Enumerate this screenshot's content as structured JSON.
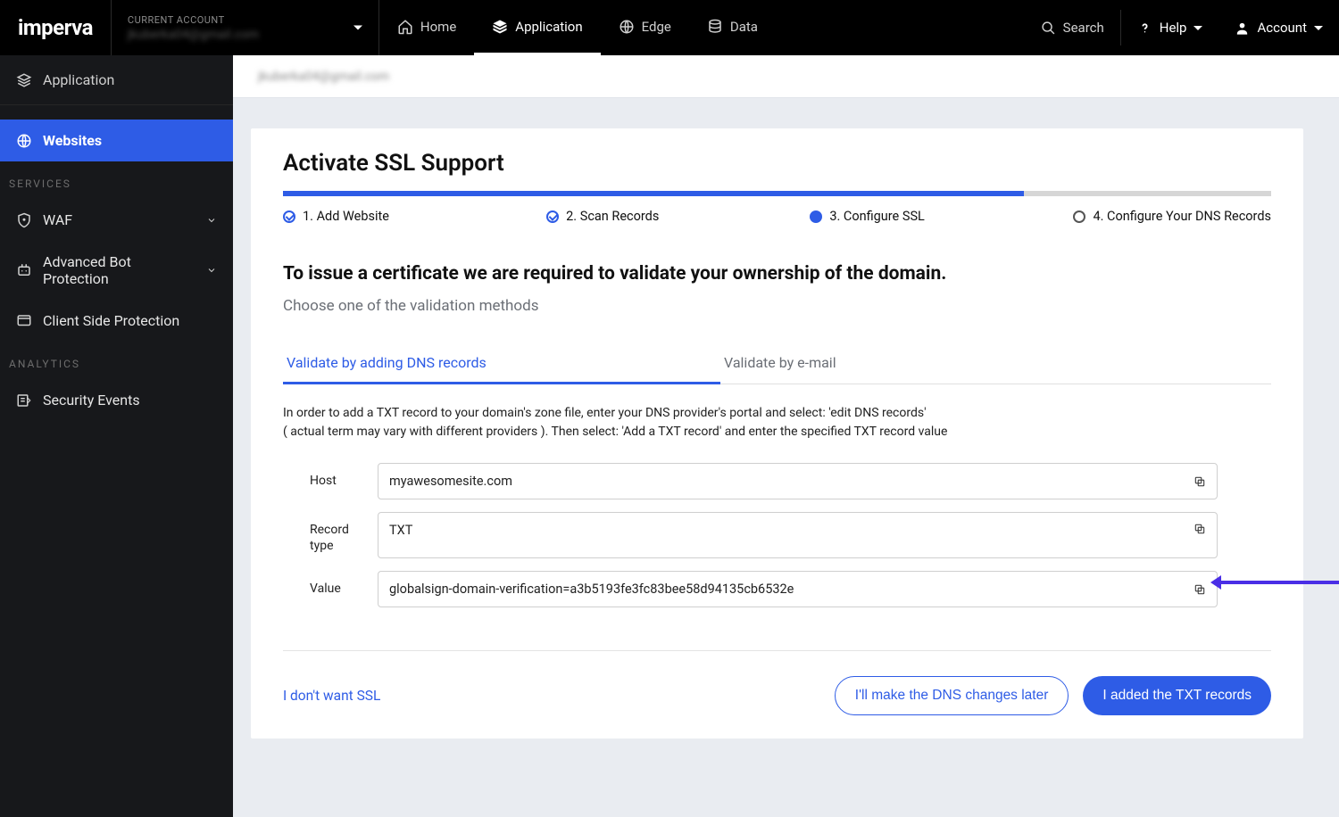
{
  "brand": "imperva",
  "account": {
    "label": "CURRENT ACCOUNT",
    "value": "jkuberka04@gmail.com"
  },
  "topnav": {
    "home": "Home",
    "application": "Application",
    "edge": "Edge",
    "data": "Data",
    "search": "Search",
    "help": "Help",
    "account": "Account"
  },
  "sidebar": {
    "header": "Application",
    "websites": "Websites",
    "services_label": "SERVICES",
    "waf": "WAF",
    "abp": "Advanced Bot Protection",
    "csp": "Client Side Protection",
    "analytics_label": "ANALYTICS",
    "security_events": "Security Events"
  },
  "breadcrumb": "jkuberka04@gmail.com",
  "page": {
    "title": "Activate SSL Support",
    "steps": {
      "s1": "1. Add Website",
      "s2": "2. Scan Records",
      "s3": "3. Configure SSL",
      "s4": "4. Configure Your DNS Records"
    },
    "headline": "To issue a certificate we are required to validate your ownership of the domain.",
    "subhead": "Choose one of the validation methods",
    "tabs": {
      "dns": "Validate by adding DNS records",
      "email": "Validate by e-mail"
    },
    "help_line1": "In order to add a TXT record to your domain's zone file, enter your DNS provider's portal and select: 'edit DNS records'",
    "help_line2": "( actual term may vary with different providers ). Then select: 'Add a TXT record' and enter the specified TXT record value",
    "form": {
      "host_label": "Host",
      "host_value": "myawesomesite.com",
      "recordtype_label": "Record type",
      "recordtype_value": "TXT",
      "value_label": "Value",
      "value_value": "globalsign-domain-verification=a3b5193fe3fc83bee58d94135cb6532e"
    },
    "footer": {
      "skip": "I don't want SSL",
      "later": "I'll make the DNS changes later",
      "done": "I added the TXT records"
    }
  }
}
